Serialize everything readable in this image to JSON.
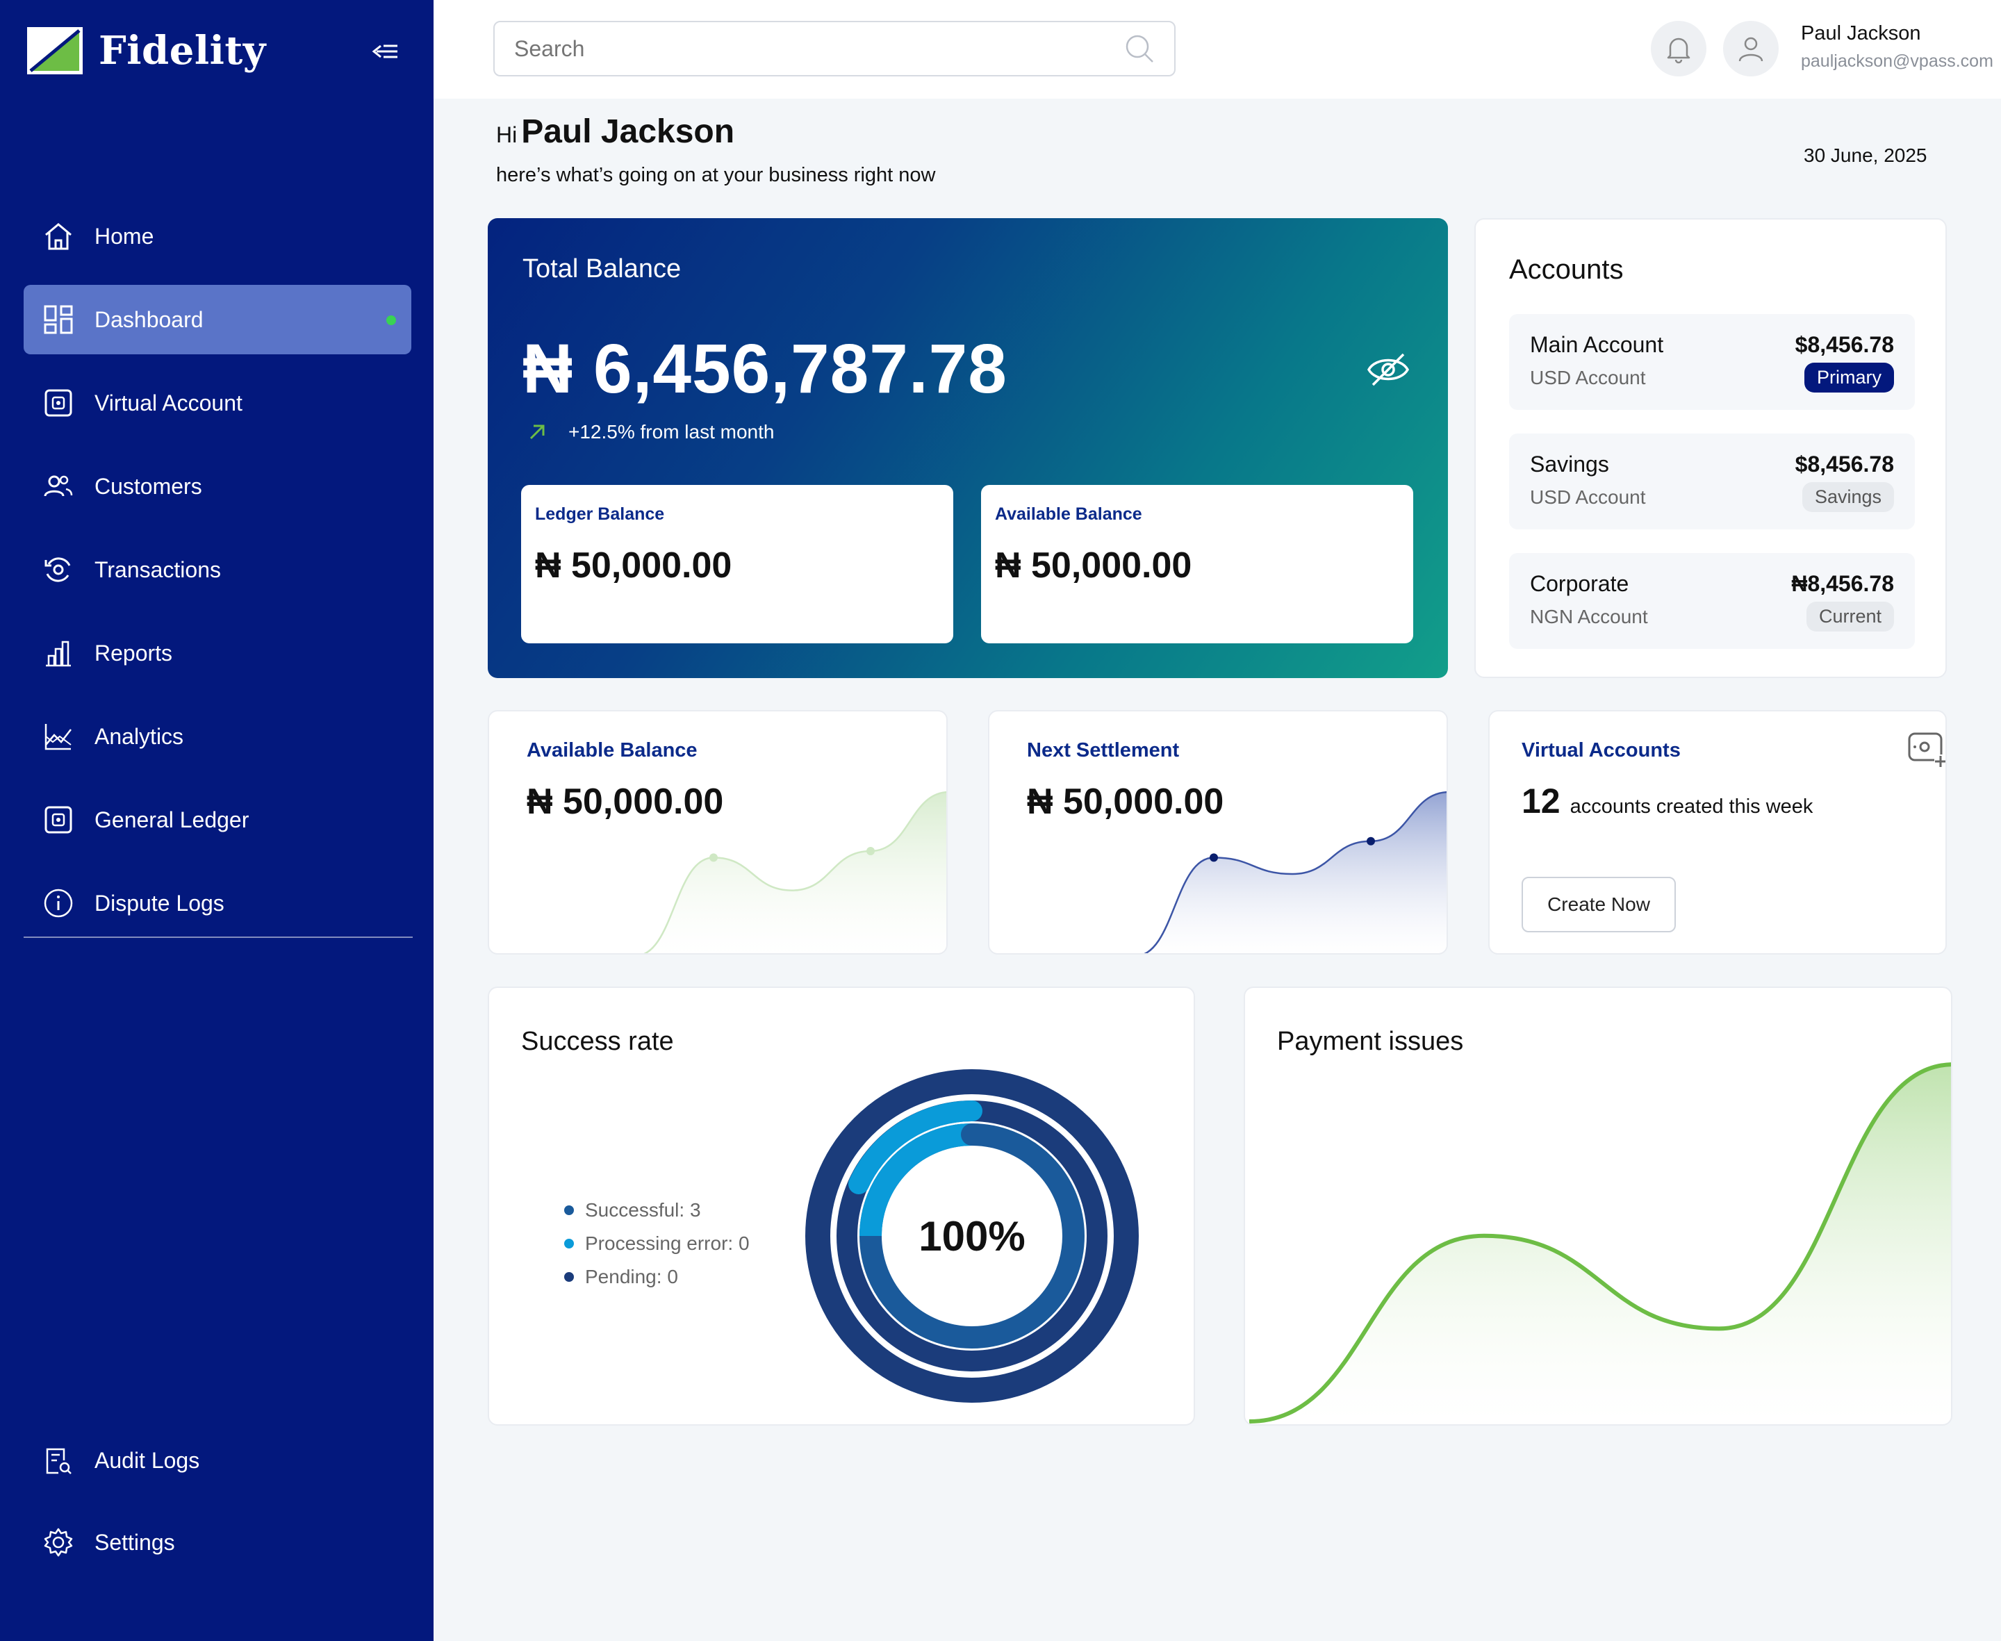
{
  "app": {
    "brand": "Fidelity"
  },
  "sidebar": {
    "items": [
      {
        "label": "Home",
        "icon": "home-icon"
      },
      {
        "label": "Dashboard",
        "icon": "dashboard-icon",
        "active": true
      },
      {
        "label": "Virtual Account",
        "icon": "virtual-account-icon"
      },
      {
        "label": "Customers",
        "icon": "customers-icon"
      },
      {
        "label": "Transactions",
        "icon": "transactions-icon"
      },
      {
        "label": "Reports",
        "icon": "reports-icon"
      },
      {
        "label": "Analytics",
        "icon": "analytics-icon"
      },
      {
        "label": "General Ledger",
        "icon": "ledger-icon"
      },
      {
        "label": "Dispute Logs",
        "icon": "info-icon"
      }
    ],
    "bottom": [
      {
        "label": "Audit Logs",
        "icon": "audit-icon"
      },
      {
        "label": "Settings",
        "icon": "gear-icon"
      }
    ]
  },
  "header": {
    "search_placeholder": "Search",
    "user_name": "Paul Jackson",
    "user_email": "pauljackson@vpass.com"
  },
  "greeting": {
    "hi": "Hi",
    "name": "Paul Jackson",
    "subtitle": "here’s what’s going on at your business right now",
    "date": "30 June, 2025"
  },
  "total_balance": {
    "label": "Total Balance",
    "value": "₦ 6,456,787.78",
    "trend": "+12.5% from last month",
    "ledger_label": "Ledger Balance",
    "ledger_value": "₦ 50,000.00",
    "available_label": "Available Balance",
    "available_value": "₦ 50,000.00"
  },
  "accounts": {
    "title": "Accounts",
    "items": [
      {
        "name": "Main Account",
        "type": "USD Account",
        "balance": "$8,456.78",
        "badge": "Primary"
      },
      {
        "name": "Savings",
        "type": "USD Account",
        "balance": "$8,456.78",
        "badge": "Savings"
      },
      {
        "name": "Corporate",
        "type": "NGN Account",
        "balance": "₦8,456.78",
        "badge": "Current"
      }
    ]
  },
  "available_balance": {
    "title": "Available Balance",
    "value": "₦ 50,000.00"
  },
  "next_settlement": {
    "title": "Next Settlement",
    "value": "₦ 50,000.00"
  },
  "virtual_accounts": {
    "title": "Virtual Accounts",
    "count": "12",
    "text": "accounts created this week",
    "button": "Create Now"
  },
  "success_rate": {
    "title": "Success rate",
    "center_label": "100%",
    "legend": [
      {
        "label": "Successful: 3",
        "color": "#1a5a9b"
      },
      {
        "label": "Processing error: 0",
        "color": "#0a9bd9"
      },
      {
        "label": "Pending: 0",
        "color": "#1b3c7b"
      }
    ]
  },
  "payment_issues": {
    "title": "Payment issues"
  },
  "colors": {
    "sidebar": "#03187d",
    "accent_green": "#6dbd45",
    "active_item": "#5a74c8",
    "navy": "#0b2a8a"
  },
  "chart_data": [
    {
      "type": "area",
      "series": [
        {
          "values": [
            0,
            3,
            2,
            3.2,
            5
          ]
        }
      ],
      "color": "#cfe8c4"
    },
    {
      "type": "area",
      "series": [
        {
          "values": [
            0,
            3,
            2.5,
            3.5,
            5
          ]
        }
      ],
      "color": "#8e9fd1"
    },
    {
      "type": "pie",
      "categories": [
        "Successful",
        "Processing error",
        "Pending"
      ],
      "values": [
        3,
        0,
        0
      ]
    },
    {
      "type": "area",
      "series": [
        {
          "values": [
            0,
            2.6,
            1.3,
            5
          ]
        }
      ],
      "color": "#6dbd45"
    }
  ]
}
